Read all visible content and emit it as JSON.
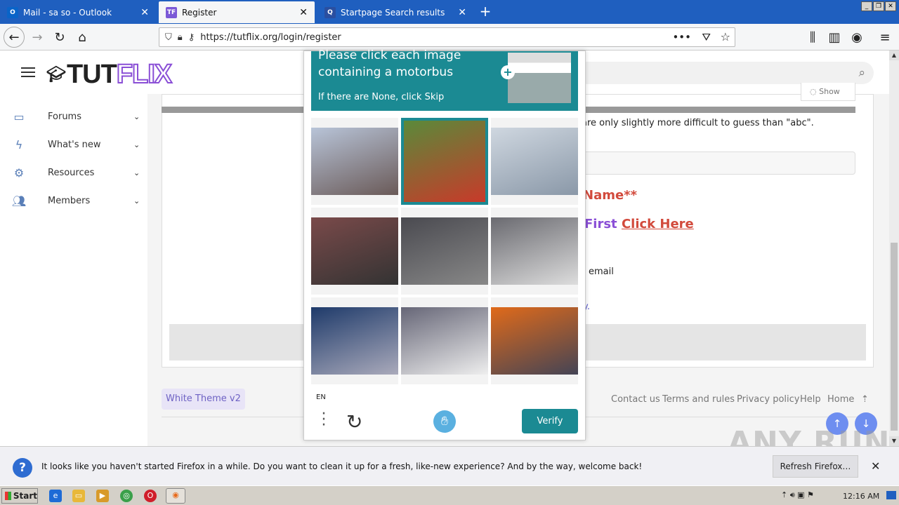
{
  "tabs": [
    {
      "label": "Mail - sa so - Outlook",
      "favicon": "O",
      "color": "#0a64c8"
    },
    {
      "label": "Register",
      "favicon": "TF",
      "color": "#7b59d6"
    },
    {
      "label": "Startpage Search results",
      "favicon": "Q",
      "color": "#2a4fa0"
    }
  ],
  "url": "https://tutflix.org/login/register",
  "site": {
    "logo_a": "TUT",
    "logo_b": "FLIX",
    "nav": [
      {
        "label": "Forums",
        "icon": "forums-icon"
      },
      {
        "label": "What's new",
        "icon": "bolt-icon"
      },
      {
        "label": "Resources",
        "icon": "cogs-icon"
      },
      {
        "label": "Members",
        "icon": "users-icon"
      }
    ],
    "show_label": "Show",
    "password_hint": "are only slightly more difficult to guess than \"abc\".",
    "req_name": "Name**",
    "first_text": "First",
    "click_here": "Click Here",
    "email_text": "email",
    "dot_link": "y.",
    "theme": "White Theme v2",
    "footer_links": [
      "Contact us",
      "Terms and rules",
      "Privacy policy",
      "Help",
      "Home"
    ]
  },
  "captcha": {
    "title_line1": "Please click each image",
    "title_line2": "containing a motorbus",
    "subtitle": "If there are None, click Skip",
    "lang": "EN",
    "verify": "Verify",
    "cells": [
      {
        "desc": "truck",
        "colors": [
          "#b8c4d8",
          "#6a5a58"
        ]
      },
      {
        "desc": "red bus",
        "colors": [
          "#5a8a3a",
          "#c83a2a"
        ],
        "selected": true
      },
      {
        "desc": "airplane",
        "colors": [
          "#cfd7e0",
          "#8a98a8"
        ]
      },
      {
        "desc": "bikes",
        "colors": [
          "#7a4a4a",
          "#333"
        ]
      },
      {
        "desc": "traffic",
        "colors": [
          "#4a4a50",
          "#888"
        ]
      },
      {
        "desc": "bus station",
        "colors": [
          "#6a6a70",
          "#ddd"
        ]
      },
      {
        "desc": "truck blue",
        "colors": [
          "#1e3a6a",
          "#aab"
        ]
      },
      {
        "desc": "airplane white",
        "colors": [
          "#667",
          "#eee"
        ]
      },
      {
        "desc": "orange car",
        "colors": [
          "#e06a1a",
          "#445"
        ]
      }
    ]
  },
  "notification": {
    "message": "It looks like you haven't started Firefox in a while. Do you want to clean it up for a fresh, like-new experience? And by the way, welcome back!",
    "button": "Refresh Firefox…"
  },
  "taskbar": {
    "start": "Start",
    "clock": "12:16 AM"
  },
  "watermark": "ANY RUN"
}
